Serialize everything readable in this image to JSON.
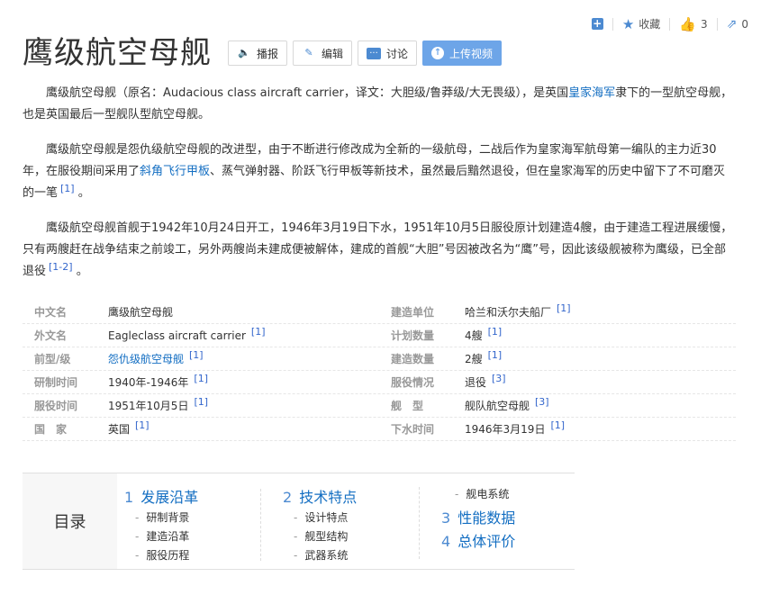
{
  "actions": {
    "collect_label": "收藏",
    "like_count": "3",
    "share_count": "0"
  },
  "title": "鹰级航空母舰",
  "toolbar": {
    "play_label": "播报",
    "edit_label": "编辑",
    "discuss_label": "讨论",
    "upload_label": "上传视频"
  },
  "paragraphs": {
    "p1": {
      "t1": "鹰级航空母舰（原名：Audacious class aircraft carrier，译文：大胆级/鲁莽级/大无畏级），是英国",
      "link1": "皇家海军",
      "t2": "隶下的一型航空母舰，也是英国最后一型舰队型航空母舰。"
    },
    "p2": {
      "t1": "鹰级航空母舰是怨仇级航空母舰的改进型，由于不断进行修改成为全新的一级航母，二战后作为皇家海军航母第一编队的主力近30年，在服役期间采用了",
      "link1": "斜角飞行甲板",
      "t2": "、蒸气弹射器、阶跃飞行甲板等新技术，虽然最后黯然退役，但在皇家海军的历史中留下了不可磨灭的一笔",
      "ref": "[1]",
      "t3": " 。"
    },
    "p3": {
      "t1": "鹰级航空母舰首舰于1942年10月24日开工，1946年3月19日下水，1951年10月5日服役原计划建造4艘，由于建造工程进展缓慢，只有两艘赶在战争结束之前竣工，另外两艘尚未建成便被解体，建成的首舰“大胆”号因被改名为“鹰”号，因此该级舰被称为鹰级，已全部退役",
      "ref": "[1-2]",
      "t2": " 。"
    }
  },
  "infobox": {
    "left": [
      {
        "key": "中文名",
        "value": "鹰级航空母舰",
        "ref": ""
      },
      {
        "key": "外文名",
        "value": "Eagleclass aircraft carrier",
        "ref": "[1]"
      },
      {
        "key": "前型/级",
        "value": "怨仇级航空母舰",
        "ref": "[1]"
      },
      {
        "key": "研制时间",
        "value": "1940年-1946年",
        "ref": "[1]"
      },
      {
        "key": "服役时间",
        "value": "1951年10月5日",
        "ref": "[1]"
      },
      {
        "key": "国　家",
        "value": "英国",
        "ref": "[1]"
      }
    ],
    "right": [
      {
        "key": "建造单位",
        "value": "哈兰和沃尔夫船厂",
        "ref": "[1]"
      },
      {
        "key": "计划数量",
        "value": "4艘",
        "ref": "[1]"
      },
      {
        "key": "建造数量",
        "value": "2艘",
        "ref": "[1]"
      },
      {
        "key": "服役情况",
        "value": "退役",
        "ref": "[3]"
      },
      {
        "key": "舰　型",
        "value": "舰队航空母舰",
        "ref": "[3]"
      },
      {
        "key": "下水时间",
        "value": "1946年3月19日",
        "ref": "[1]"
      }
    ]
  },
  "toc": {
    "label": "目录",
    "sections": [
      {
        "num": "1",
        "title": "发展沿革",
        "subs": [
          "研制背景",
          "建造沿革",
          "服役历程"
        ]
      },
      {
        "num": "2",
        "title": "技术特点",
        "subs": [
          "设计特点",
          "舰型结构",
          "武器系统"
        ]
      },
      {
        "num": "",
        "title": "",
        "subs": [
          "舰电系统"
        ]
      },
      {
        "num": "3",
        "title": "性能数据",
        "subs": []
      },
      {
        "num": "4",
        "title": "总体评价",
        "subs": []
      }
    ]
  }
}
